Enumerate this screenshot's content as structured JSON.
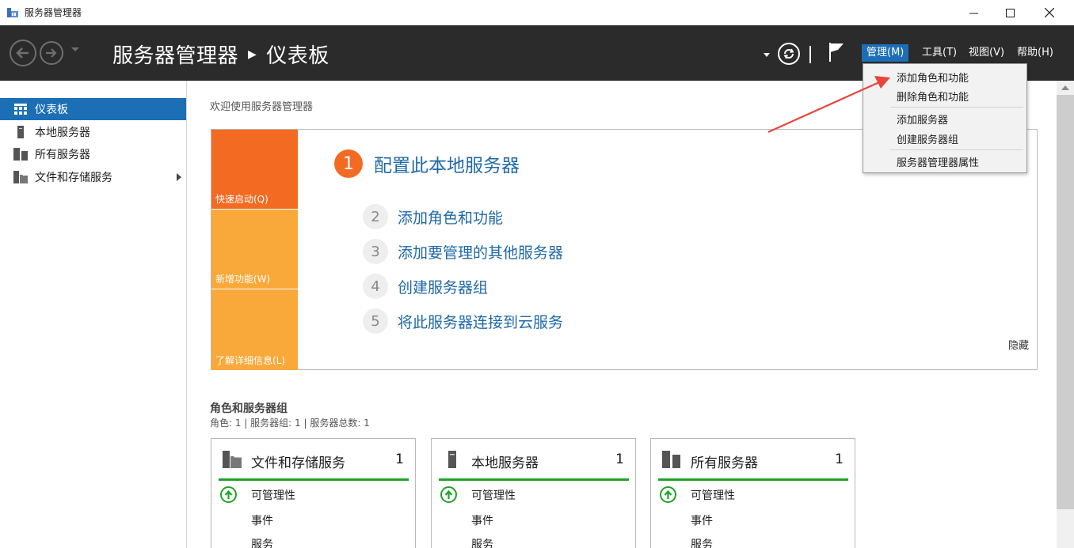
{
  "window": {
    "title": "服务器管理器"
  },
  "header": {
    "breadcrumb_root": "服务器管理器",
    "breadcrumb_current": "仪表板",
    "menus": [
      {
        "label": "管理(M)",
        "active": true
      },
      {
        "label": "工具(T)"
      },
      {
        "label": "视图(V)"
      },
      {
        "label": "帮助(H)"
      }
    ]
  },
  "manage_menu": {
    "items": [
      "添加角色和功能",
      "删除角色和功能",
      "添加服务器",
      "创建服务器组",
      "服务器管理器属性"
    ]
  },
  "sidebar": {
    "items": [
      {
        "label": "仪表板",
        "icon": "dashboard-icon",
        "selected": true
      },
      {
        "label": "本地服务器",
        "icon": "local-server-icon"
      },
      {
        "label": "所有服务器",
        "icon": "all-servers-icon"
      },
      {
        "label": "文件和存储服务",
        "icon": "file-storage-icon",
        "expandable": true
      }
    ]
  },
  "main": {
    "welcome_title": "欢迎使用服务器管理器",
    "tiles": [
      "快速启动(Q)",
      "新增功能(W)",
      "了解详细信息(L)"
    ],
    "steps": [
      {
        "num": "1",
        "label": "配置此本地服务器"
      },
      {
        "num": "2",
        "label": "添加角色和功能"
      },
      {
        "num": "3",
        "label": "添加要管理的其他服务器"
      },
      {
        "num": "4",
        "label": "创建服务器组"
      },
      {
        "num": "5",
        "label": "将此服务器连接到云服务"
      }
    ],
    "hide_label": "隐藏",
    "roles_title": "角色和服务器组",
    "roles_summary": "角色: 1 | 服务器组: 1 | 服务器总数: 1",
    "cards": [
      {
        "title": "文件和存储服务",
        "count": "1",
        "icon": "file-storage-icon",
        "rows": [
          "可管理性",
          "事件",
          "服务"
        ]
      },
      {
        "title": "本地服务器",
        "count": "1",
        "icon": "local-server-icon",
        "rows": [
          "可管理性",
          "事件",
          "服务"
        ]
      },
      {
        "title": "所有服务器",
        "count": "1",
        "icon": "all-servers-icon",
        "rows": [
          "可管理性",
          "事件",
          "服务"
        ]
      }
    ]
  },
  "colors": {
    "accent": "#1c6fb5",
    "header_bg": "#2b2b2b",
    "quick_start": "#f36b22",
    "tile_light": "#f9a83a",
    "status_green": "#1fa32a",
    "link": "#1f69a8",
    "annotation_arrow": "#e8453c"
  }
}
